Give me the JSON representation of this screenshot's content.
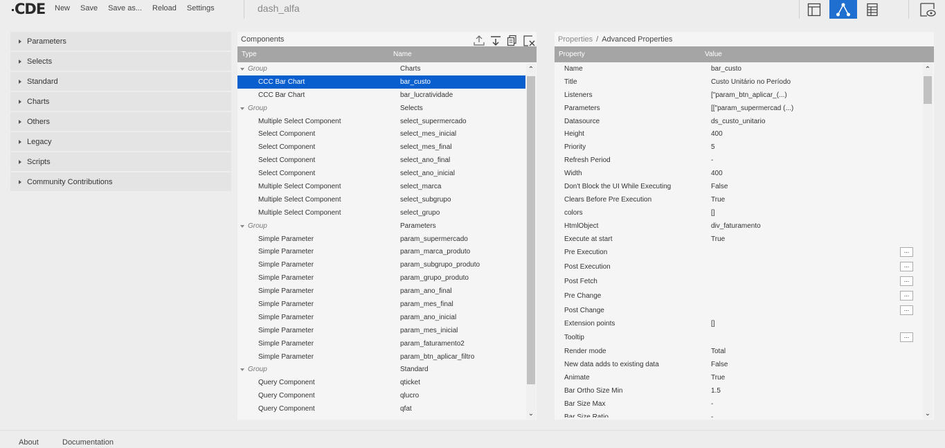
{
  "topbar": {
    "logo": "CDE",
    "menu": [
      "New",
      "Save",
      "Save as...",
      "Reload",
      "Settings"
    ],
    "dashboard_title": "dash_alfa",
    "accent": "#1f6fd1"
  },
  "left_panel": {
    "items": [
      "Parameters",
      "Selects",
      "Standard",
      "Charts",
      "Others",
      "Legacy",
      "Scripts",
      "Community Contributions"
    ]
  },
  "components": {
    "title": "Components",
    "col_type": "Type",
    "col_name": "Name",
    "rows": [
      {
        "type": "Group",
        "name": "Charts",
        "group": true
      },
      {
        "type": "CCC Bar Chart",
        "name": "bar_custo",
        "selected": true
      },
      {
        "type": "CCC Bar Chart",
        "name": "bar_lucratividade"
      },
      {
        "type": "Group",
        "name": "Selects",
        "group": true
      },
      {
        "type": "Multiple Select Component",
        "name": "select_supermercado"
      },
      {
        "type": "Select Component",
        "name": "select_mes_inicial"
      },
      {
        "type": "Select Component",
        "name": "select_mes_final"
      },
      {
        "type": "Select Component",
        "name": "select_ano_final"
      },
      {
        "type": "Select Component",
        "name": "select_ano_inicial"
      },
      {
        "type": "Multiple Select Component",
        "name": "select_marca"
      },
      {
        "type": "Multiple Select Component",
        "name": "select_subgrupo"
      },
      {
        "type": "Multiple Select Component",
        "name": "select_grupo"
      },
      {
        "type": "Group",
        "name": "Parameters",
        "group": true
      },
      {
        "type": "Simple Parameter",
        "name": "param_supermercado"
      },
      {
        "type": "Simple Parameter",
        "name": "param_marca_produto"
      },
      {
        "type": "Simple Parameter",
        "name": "param_subgrupo_produto"
      },
      {
        "type": "Simple Parameter",
        "name": "param_grupo_produto"
      },
      {
        "type": "Simple Parameter",
        "name": "param_ano_final"
      },
      {
        "type": "Simple Parameter",
        "name": "param_mes_final"
      },
      {
        "type": "Simple Parameter",
        "name": "param_ano_inicial"
      },
      {
        "type": "Simple Parameter",
        "name": "param_mes_inicial"
      },
      {
        "type": "Simple Parameter",
        "name": "param_faturamento2"
      },
      {
        "type": "Simple Parameter",
        "name": "param_btn_aplicar_filtro"
      },
      {
        "type": "Group",
        "name": "Standard",
        "group": true
      },
      {
        "type": "Query Component",
        "name": "qticket"
      },
      {
        "type": "Query Component",
        "name": "qlucro"
      },
      {
        "type": "Query Component",
        "name": "qfat"
      }
    ]
  },
  "properties": {
    "breadcrumb_1": "Properties",
    "breadcrumb_sep": "/",
    "breadcrumb_2": "Advanced Properties",
    "col_property": "Property",
    "col_value": "Value",
    "button_label": "...",
    "rows": [
      {
        "p": "Name",
        "v": "bar_custo"
      },
      {
        "p": "Title",
        "v": "Custo Unitário no Período"
      },
      {
        "p": "Listeners",
        "v": "[\"param_btn_aplicar_(...)"
      },
      {
        "p": "Parameters",
        "v": "[[\"param_supermercad (...)"
      },
      {
        "p": "Datasource",
        "v": "ds_custo_unitario"
      },
      {
        "p": "Height",
        "v": "400"
      },
      {
        "p": "Priority",
        "v": "5"
      },
      {
        "p": "Refresh Period",
        "v": "-"
      },
      {
        "p": "Width",
        "v": "400"
      },
      {
        "p": "Don't Block the UI While Executing",
        "v": "False"
      },
      {
        "p": "Clears Before Pre Execution",
        "v": "True"
      },
      {
        "p": "colors",
        "v": "[]"
      },
      {
        "p": "HtmlObject",
        "v": "div_faturamento"
      },
      {
        "p": "Execute at start",
        "v": "True"
      },
      {
        "p": "Pre Execution",
        "v": "",
        "btn": true
      },
      {
        "p": "Post Execution",
        "v": "",
        "btn": true
      },
      {
        "p": "Post Fetch",
        "v": "",
        "btn": true
      },
      {
        "p": "Pre Change",
        "v": "",
        "btn": true
      },
      {
        "p": "Post Change",
        "v": "",
        "btn": true
      },
      {
        "p": "Extension points",
        "v": "[]"
      },
      {
        "p": "Tooltip",
        "v": "",
        "btn": true
      },
      {
        "p": "Render mode",
        "v": "Total"
      },
      {
        "p": "New data adds to existing data",
        "v": "False"
      },
      {
        "p": "Animate",
        "v": "True"
      },
      {
        "p": "Bar Ortho Size Min",
        "v": "1.5"
      },
      {
        "p": "Bar Size Max",
        "v": "-"
      },
      {
        "p": "Bar Size Ratio",
        "v": "-"
      }
    ]
  },
  "footer": {
    "about": "About",
    "documentation": "Documentation"
  }
}
